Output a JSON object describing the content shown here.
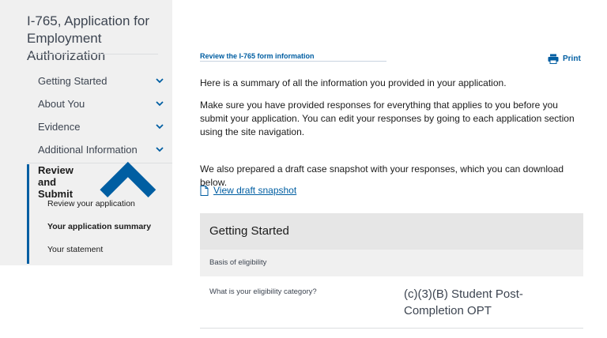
{
  "sidebar": {
    "title": "I-765, Application for Employment Authorization",
    "nav_items": [
      {
        "label": "Getting Started"
      },
      {
        "label": "About You"
      },
      {
        "label": "Evidence"
      },
      {
        "label": "Additional Information"
      }
    ],
    "active_section": {
      "label": "Review and Submit",
      "sub_items": [
        {
          "label": "Review your application",
          "active": false
        },
        {
          "label": "Your application summary",
          "active": true
        },
        {
          "label": "Your statement",
          "active": false
        }
      ]
    }
  },
  "main": {
    "step_label": "Review the I-765 form information",
    "print_label": "Print",
    "intro": "Here is a summary of all the information you provided in your application.",
    "instructions": "Make sure you have provided responses for everything that applies to you before you submit your application. You can edit your responses by going to each application section using the site navigation.",
    "draft_text": "We also prepared a draft case snapshot with your responses, which you can download below.",
    "draft_link": "View draft snapshot",
    "summary": {
      "section_title": "Getting Started",
      "subsection_title": "Basis of eligibility",
      "question": "What is your eligibility category?",
      "answer": "(c)(3)(B) Student Post-Completion OPT"
    }
  },
  "colors": {
    "accent": "#005ea2",
    "sidebar_bg": "#f0f0f0",
    "header_bg": "#e6e6e6"
  }
}
